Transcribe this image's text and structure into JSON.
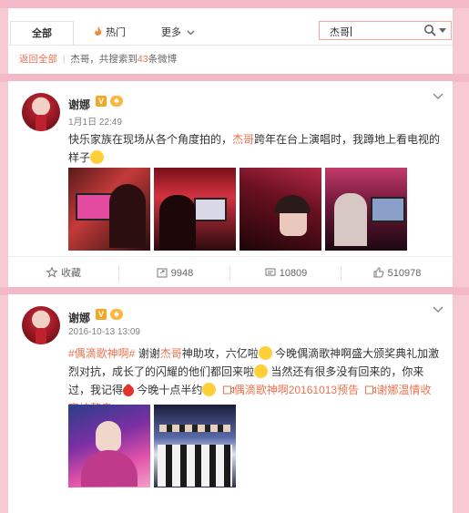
{
  "nav": {
    "tabs": [
      {
        "label": "全部",
        "active": true
      },
      {
        "label": "热门",
        "icon": "fire-icon"
      },
      {
        "label": "更多",
        "icon": "chevron-down-icon"
      }
    ],
    "search": {
      "value": "杰哥"
    }
  },
  "breadcrumb": {
    "back": "返回全部",
    "prefix": "杰哥，共搜索到",
    "count": "43",
    "suffix": "条微博"
  },
  "posts": [
    {
      "user": "谢娜",
      "time": "1月1日 22:49",
      "text_a": "快乐家族在现场从各个角度拍的，",
      "text_hl": "杰哥",
      "text_b": "跨年在台上演唱时，我蹲地上看电视的样子",
      "actions": {
        "favorite": "收藏",
        "repost": "9948",
        "comment": "10809",
        "like": "510978"
      }
    },
    {
      "user": "谢娜",
      "time": "2016-10-13 13:09",
      "topic": "#偶滴歌神啊#",
      "text_a": " 谢谢",
      "text_hl": "杰哥",
      "text_b": "神助攻，六亿啦",
      "text_c": " 今晚偶滴歌神啊盛大颁奖典礼加激烈对抗，成长了的闪耀的他们都回来啦",
      "text_d": " 当然还有很多没有回来的，你来过，我记得",
      "text_e": " 今晚十点半约",
      "link1": "偶滴歌神啊20161013预告",
      "link2": "谢娜温情收官被整蛊"
    }
  ],
  "colors": {
    "accent": "#eb7350",
    "background": "#f6c9d3"
  }
}
